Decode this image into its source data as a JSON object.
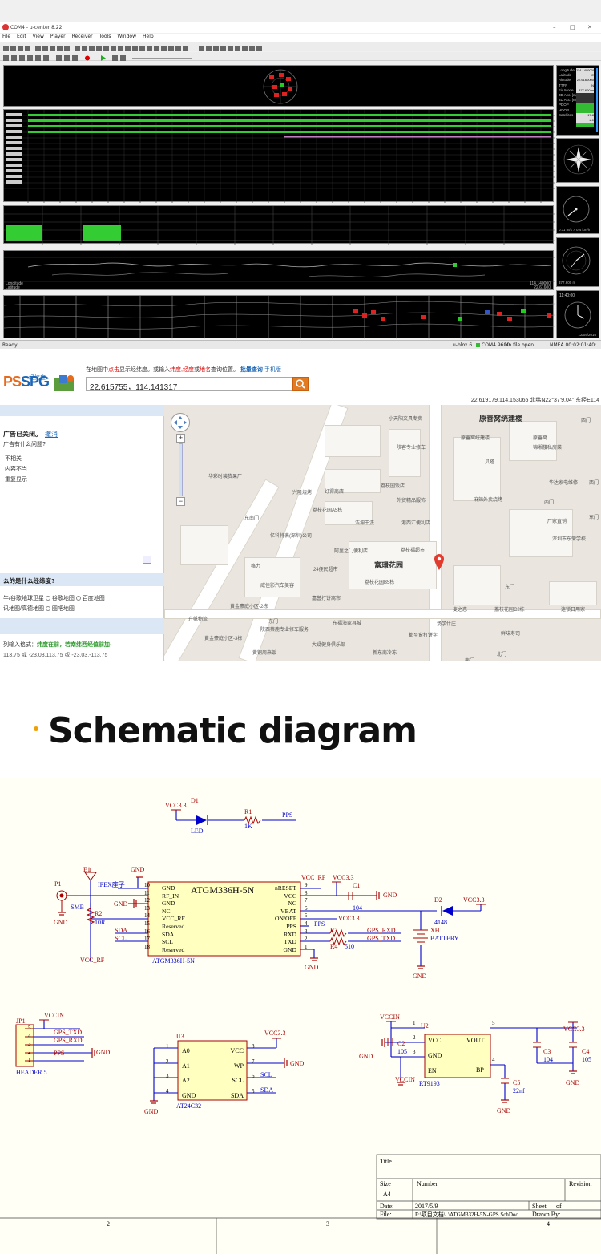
{
  "ucenter": {
    "title": "COM4 - u-center 8.22",
    "menu": [
      "File",
      "Edit",
      "View",
      "Player",
      "Receiver",
      "Tools",
      "Window",
      "Help"
    ],
    "side_labels": [
      "Longitude",
      "Latitude",
      "Altitude",
      "TTFF",
      "Fix Mode",
      "3D Acc. [m]",
      "2D Acc. [m]",
      "PDOP",
      "HDOP",
      "Satellites"
    ],
    "side_values": [
      "114.1400000 E",
      "22.6160000 N",
      "377.600 m",
      "",
      "",
      "",
      "",
      "17.8",
      "2.1",
      ""
    ],
    "speed_text": "0.11 m/s  > 0.4 km/h",
    "alt_text": "377.600 m",
    "time_text": "11:40:00",
    "date_text": "12/05/2016",
    "lon_label": "Longitude",
    "lat_label": "Latitude",
    "lon_value": "114.140000",
    "lat_value": "22.61600",
    "status_ready": "Ready",
    "status_rx": "u-blox 6",
    "status_port": "COM4 9600",
    "status_file": "No file open",
    "status_nmea": "NMEA 00:02:01:40:"
  },
  "map": {
    "logo_ps": "PS",
    "logo_spg": "SPG",
    "logo_sub": "经纬度",
    "hint_1": "在地图中",
    "hint_2": "点击",
    "hint_3": "显示经纬度。或输入",
    "hint_4": "纬度,经度",
    "hint_5": "或",
    "hint_6": "地名",
    "hint_7": "查询位置。",
    "hint_8": "批量查询",
    "hint_9": "手机版",
    "search_value": "22.615755，114.141317",
    "coord_line": "22.619179,114.153065 北纬N22°37'9.04\" 东经E114",
    "ad_closed": "广告已关闭。",
    "ad_undo": "撤消",
    "ad_q": "广告有什么问题?",
    "ad_o1": "不相关",
    "ad_o2": "内容不当",
    "ad_o3": "重复显示",
    "what_is": "么的是什么经纬度?",
    "map_opt1": "牛/谷歌地球卫星",
    "map_opt2": "谷歌地图",
    "map_opt3": "百度地图",
    "map_opt4": "讯地图/高德地图",
    "map_opt5": "图吧地图",
    "fmt_label": "列输入格式：",
    "fmt_green": "纬度在前，若南纬西经值前加-",
    "fmt_ex": "113.75 或 -23.03,113.75 或 -23.03,-113.75",
    "labels": {
      "l1": "原善窝统建楼",
      "l2": "富璟花园",
      "l3": "华彩时装货果厂",
      "l4": "东南门",
      "l5": "亿科特表(深圳)公司",
      "l6": "阿里之门便利店",
      "l7": "24便民超市",
      "l8": "格力",
      "l9": "威佳影汽车美容",
      "l10": "嘉誉打饼窝帘",
      "l11": "黄金豪庭小区-2栋",
      "l12": "升帆物流",
      "l13": "东门",
      "l14": "东福海家具城",
      "l15": "陕西蔡鹿专业修车服务",
      "l16": "大疑健身俱乐部",
      "l17": "黄金豪庭小区-3栋",
      "l18": "黄铜周来饭",
      "l19": "新东南冷冻",
      "l20": "都至窗打饼字",
      "l21": "汤学什庄",
      "l22": "麦之恋",
      "l23": "荔枝花园C2栋",
      "l24": "鲜味寿司",
      "l25": "东门",
      "l26": "北门",
      "l27": "南门",
      "l28": "西门",
      "l29": "连锁日用家",
      "l30": "小天阳文具专卖",
      "l31": "陕客专业修车",
      "l32": "荔枝园饭店",
      "l33": "外贸精品服饰",
      "l34": "荔枝花园A5栋",
      "l35": "好得商店",
      "l36": "兴隆烧烤",
      "l37": "洁坤干洗",
      "l38": "港西汇便利店",
      "l39": "荔枝花园B5栋",
      "l40": "荔枝福超市",
      "l41": "原善窝统建楼",
      "l42": "贝塔",
      "l43": "原善窝",
      "l44": "锦湘楼私房菜",
      "l45": "华达家电维修",
      "l46": "麻辣外卖烧烤",
      "l47": "厂家直销",
      "l48": "深圳市东荣学校",
      "l49": "丙门",
      "l50": "西门",
      "l51": "东门"
    }
  },
  "section_heading": "Schematic diagram",
  "schematic": {
    "vcc33": "VCC3.3",
    "d1": "D1",
    "led": "LED",
    "r1": "R1",
    "r1v": "1K",
    "pps": "PPS",
    "e1": "E1",
    "ipex": "IPEX座子",
    "gnd": "GND",
    "p1": "P1",
    "smb": "SMB",
    "r2": "R2",
    "r2v": "10R",
    "vcc_rf": "VCC_RF",
    "chip": "ATGM336H-5N",
    "chip_ref": "ATGM336H-5N",
    "left_pins": [
      "GND",
      "RF_IN",
      "GND",
      "NC",
      "VCC_RF",
      "Reserved",
      "SDA",
      "SCL",
      "Reserved"
    ],
    "left_nums": [
      "10",
      "11",
      "12",
      "13",
      "14",
      "15",
      "16",
      "17",
      "18"
    ],
    "right_pins": [
      "nRESET",
      "VCC",
      "NC",
      "VBAT",
      "ON/OFF",
      "PPS",
      "RXD",
      "TXD",
      "GND"
    ],
    "right_nums": [
      "9",
      "8",
      "7",
      "6",
      "5",
      "4",
      "3",
      "2",
      "1"
    ],
    "sda": "SDA",
    "scl": "SCL",
    "c1": "C1",
    "c1v": "104",
    "d2": "D2",
    "d2v": "4148",
    "xh": "XH",
    "battery": "BATTERY",
    "r3": "R3",
    "r4": "R4",
    "r4v": "510",
    "gps_rxd": "GPS_RXD",
    "gps_txd": "GPS_TXD",
    "jp1": "JP1",
    "vccin": "VCCIN",
    "header5": "HEADER 5",
    "jp_nums": [
      "5",
      "4",
      "3",
      "2",
      "1"
    ],
    "u3": "U3",
    "at24": "AT24C32",
    "u3_left": [
      "A0",
      "A1",
      "A2",
      "GND"
    ],
    "u3_lnums": [
      "1",
      "2",
      "3",
      "4"
    ],
    "u3_right": [
      "VCC",
      "WP",
      "SCL",
      "SDA"
    ],
    "u3_rnums": [
      "8",
      "7",
      "6",
      "5"
    ],
    "u2": "U2",
    "rt9193": "RT9193",
    "u2_vcc": "VCC",
    "u2_gnd": "GND",
    "u2_en": "EN",
    "u2_vout": "VOUT",
    "u2_bp": "BP",
    "c2": "C2",
    "c2v": "105",
    "c3": "C3",
    "c3v": "104",
    "c4": "C4",
    "c4v": "105",
    "c5": "C5",
    "c5v": "22nf",
    "tb_title": "Title",
    "tb_size": "Size",
    "tb_a4": "A4",
    "tb_number": "Number",
    "tb_revision": "Revision",
    "tb_date": "Date:",
    "tb_date_v": "2017/5/9",
    "tb_sheet": "Sheet",
    "tb_of": "of",
    "tb_file": "File:",
    "tb_file_v": "F:\\项目文档\\..\\ATGM332H-5N-GPS.SchDoc",
    "tb_drawn": "Drawn By:",
    "border_nums": [
      "2",
      "3",
      "4"
    ]
  }
}
